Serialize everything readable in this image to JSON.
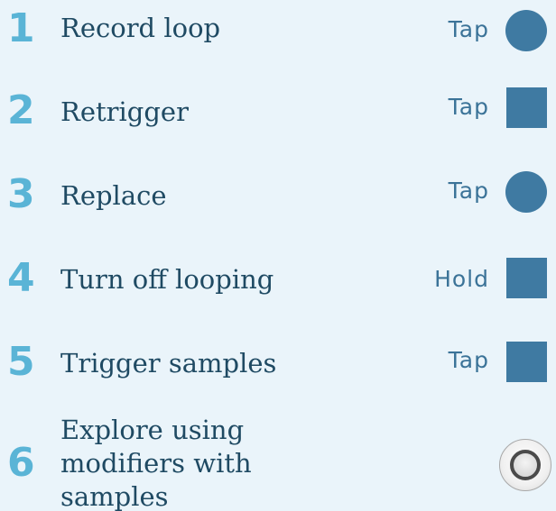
{
  "steps": [
    {
      "number": "1",
      "label": "Record loop",
      "action": "Tap",
      "pad": "circle-pad"
    },
    {
      "number": "2",
      "label": "Retrigger",
      "action": "Tap",
      "pad": "square-pad"
    },
    {
      "number": "3",
      "label": "Replace",
      "action": "Tap",
      "pad": "circle-pad"
    },
    {
      "number": "4",
      "label": "Turn off looping",
      "action": "Hold",
      "pad": "square-pad"
    },
    {
      "number": "5",
      "label": "Trigger samples",
      "action": "Tap",
      "pad": "square-pad"
    },
    {
      "number": "6",
      "label_lines": [
        "Explore using",
        "modifiers with",
        "samples"
      ],
      "pad": "knob"
    }
  ],
  "colors": {
    "background": "#eaf4fa",
    "number": "#5ab4d6",
    "label": "#1f4a63",
    "action": "#3b7398",
    "pad": "#3f7aa2"
  }
}
